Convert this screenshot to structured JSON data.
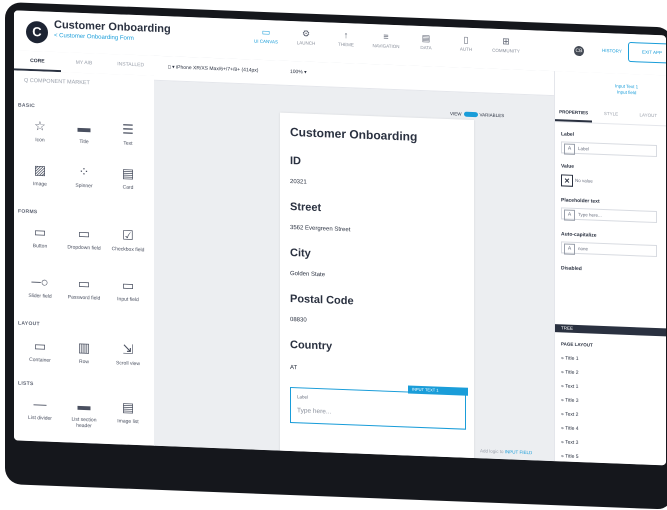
{
  "app": {
    "name": "Customer Onboarding",
    "subtitle": "< Customer Onboarding Form",
    "logo": "C"
  },
  "topnav": [
    {
      "label": "UI CANVAS",
      "icon": "▭"
    },
    {
      "label": "LAUNCH",
      "icon": "⚙"
    },
    {
      "label": "THEME",
      "icon": "↑"
    },
    {
      "label": "NAVIGATION",
      "icon": "≡"
    },
    {
      "label": "DATA",
      "icon": "▤"
    },
    {
      "label": "AUTH",
      "icon": "▯"
    },
    {
      "label": "COMMUNITY",
      "icon": "⊞"
    }
  ],
  "header_right": {
    "avatar": "CB",
    "history": "HISTORY",
    "exit": "EXIT APP"
  },
  "left_tabs": [
    "CORE",
    "MY AIB",
    "INSTALLED"
  ],
  "search_placeholder": "Q  COMPONENT MARKET",
  "sections": {
    "basic": "BASIC",
    "forms": "FORMS",
    "layout": "LAYOUT",
    "lists": "LISTS"
  },
  "basic_items": [
    {
      "label": "Icon",
      "icon": "☆"
    },
    {
      "label": "Title",
      "icon": "▬"
    },
    {
      "label": "Text",
      "icon": "☰"
    },
    {
      "label": "Image",
      "icon": "▨"
    },
    {
      "label": "Spinner",
      "icon": "⁘"
    },
    {
      "label": "Card",
      "icon": "▤"
    }
  ],
  "form_items": [
    {
      "label": "Button",
      "icon": "▭"
    },
    {
      "label": "Dropdown field",
      "icon": "▭"
    },
    {
      "label": "Checkbox field",
      "icon": "☑"
    },
    {
      "label": "Slider field",
      "icon": "─○"
    },
    {
      "label": "Password field",
      "icon": "▭"
    },
    {
      "label": "Input field",
      "icon": "▭"
    }
  ],
  "layout_items": [
    {
      "label": "Container",
      "icon": "▭"
    },
    {
      "label": "Row",
      "icon": "▥"
    },
    {
      "label": "Scroll view",
      "icon": "⇲"
    }
  ],
  "list_items": [
    {
      "label": "List divider",
      "icon": "—"
    },
    {
      "label": "List section header",
      "icon": "▬"
    },
    {
      "label": "Image list",
      "icon": "▤"
    }
  ],
  "canvas": {
    "device": "▯ ▾  iPhone XR/XS Max/6+/7+/8+ (414px)",
    "zoom": "100% ▾",
    "view_label": "VIEW",
    "variables_label": "VARIABLES",
    "screen_title": "Customer Onboarding",
    "fields": [
      {
        "heading": "ID",
        "value": "20321"
      },
      {
        "heading": "Street",
        "value": "3562 Evergreen Street"
      },
      {
        "heading": "City",
        "value": "Golden State"
      },
      {
        "heading": "Postal Code",
        "value": "08830"
      },
      {
        "heading": "Country",
        "value": "AT"
      }
    ],
    "input_label": "Label",
    "input_placeholder": "Type here...",
    "input_tag": "INPUT TEXT 1",
    "add_logic": "Add logic to",
    "add_logic_target": "INPUT FIELD"
  },
  "right_panel": {
    "selected": "Input Text 1",
    "selected_sub": "Input field",
    "tabs": [
      "PROPERTIES",
      "STYLE",
      "LAYOUT"
    ],
    "label_title": "Label",
    "label_value": "Label",
    "value_title": "Value",
    "value_value": "No value",
    "placeholder_title": "Placeholder text",
    "placeholder_value": "Type here...",
    "autocap_title": "Auto-capitalize",
    "autocap_value": "none",
    "disabled_title": "Disabled",
    "dark_bar": "TREE",
    "page_layout": "PAGE LAYOUT",
    "layout_items": [
      "Title 1",
      "Title 2",
      "Text 1",
      "Title 3",
      "Text 2",
      "Title 4",
      "Text 3",
      "Title 5"
    ]
  }
}
